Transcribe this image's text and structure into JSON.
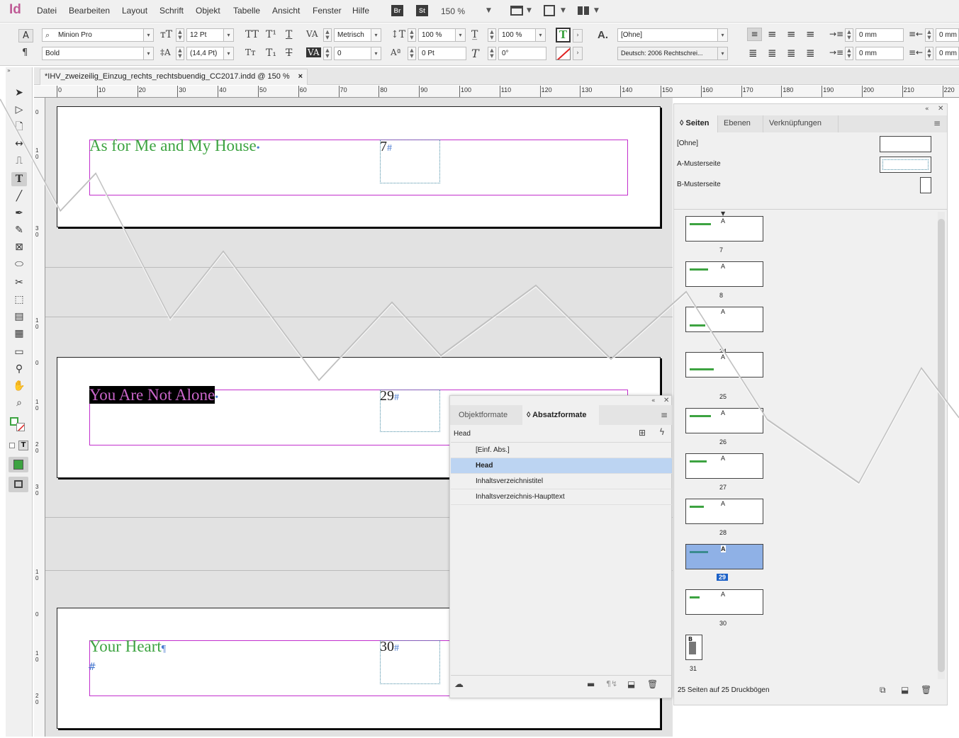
{
  "app": {
    "logo": "Id"
  },
  "menu": [
    "Datei",
    "Bearbeiten",
    "Layout",
    "Schrift",
    "Objekt",
    "Tabelle",
    "Ansicht",
    "Fenster",
    "Hilfe"
  ],
  "bridge": {
    "br": "Br",
    "st": "St"
  },
  "zoom": "150 %",
  "control": {
    "font_family": "Minion Pro",
    "font_style": "Bold",
    "font_size": "12 Pt",
    "leading": "(14,4 Pt)",
    "kerning": "Metrisch",
    "tracking": "0",
    "vscale": "100 %",
    "hscale": "100 %",
    "baseline": "0 Pt",
    "skew": "0°",
    "char_style": "[Ohne]",
    "language": "Deutsch: 2006 Rechtschrei...",
    "indent_left": "0 mm",
    "indent_first": "0 mm",
    "indent_right": "0 mm",
    "indent_last": "0 mm"
  },
  "doc_tab": {
    "title": "*IHV_zweizeilig_Einzug_rechts_rechtsbuendig_CC2017.indd @ 150 %",
    "close": "×"
  },
  "ruler_h": [
    "0",
    "10",
    "20",
    "30",
    "40",
    "50",
    "60",
    "70",
    "80",
    "90",
    "100",
    "110",
    "120",
    "130",
    "140",
    "150",
    "160",
    "170",
    "180",
    "190",
    "200",
    "210",
    "220"
  ],
  "ruler_v": [
    "0",
    "1 0",
    "3 0",
    "1 0",
    "0",
    "1 0",
    "2 0",
    "3 0",
    "1 0",
    "0",
    "1 0",
    "2 0"
  ],
  "spreads": [
    {
      "heading": "As for Me and My House",
      "pilcrow": "•",
      "page_num": "7",
      "hash": "#"
    },
    {
      "heading": "You Are Not Alone",
      "pilcrow": "•",
      "page_num": "29",
      "hash": "#"
    },
    {
      "heading": "Your Heart",
      "pilcrow": "¶",
      "page_num": "30",
      "hash": "#",
      "extra_hash": "#"
    }
  ],
  "pages_panel": {
    "tabs": [
      "Seiten",
      "Ebenen",
      "Verknüpfungen"
    ],
    "masters": [
      "[Ohne]",
      "A-Musterseite",
      "B-Musterseite"
    ],
    "pages": [
      {
        "label": "7",
        "master": "A"
      },
      {
        "label": "8",
        "master": "A"
      },
      {
        "label": "24",
        "master": "A"
      },
      {
        "label": "25",
        "master": "A"
      },
      {
        "label": "26",
        "master": "A"
      },
      {
        "label": "27",
        "master": "A"
      },
      {
        "label": "28",
        "master": "A"
      },
      {
        "label": "29",
        "master": "A",
        "selected": true
      },
      {
        "label": "30",
        "master": "A"
      }
    ],
    "last_page": {
      "label": "31",
      "master": "B"
    },
    "footer": "25 Seiten auf 25 Druckbögen"
  },
  "para_panel": {
    "tabs": [
      "Objektformate",
      "Absatzformate"
    ],
    "current": "Head",
    "styles": [
      "[Einf. Abs.]",
      "Head",
      "Inhaltsverzeichnistitel",
      "Inhaltsverzeichnis-Haupttext"
    ],
    "selected": "Head"
  },
  "colors": {
    "heading_green": "#3da341",
    "frame_magenta": "#c22fcd",
    "selection_blue": "#bcd4f2",
    "page_selected": "#8fb1e6"
  }
}
